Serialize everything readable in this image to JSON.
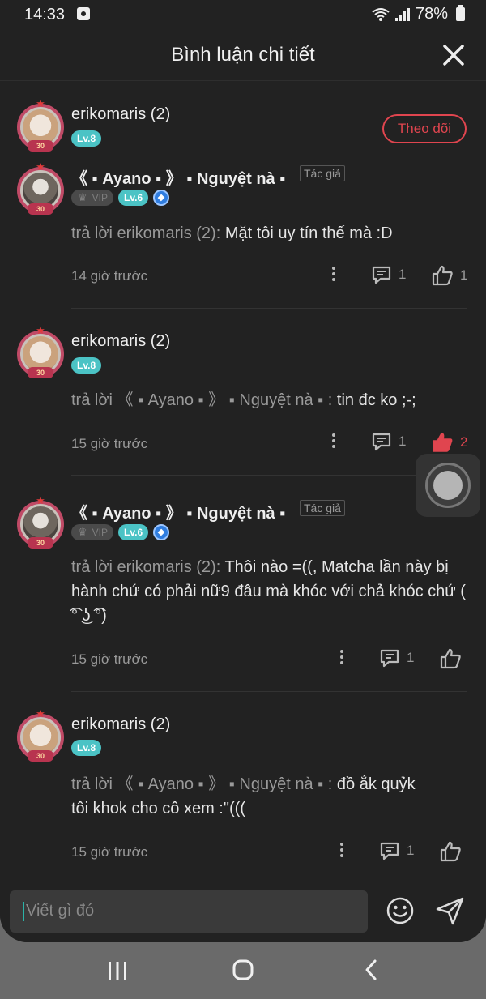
{
  "status_bar": {
    "time": "14:33",
    "battery": "78%"
  },
  "header": {
    "title": "Bình luận chi tiết"
  },
  "follow_label": "Theo dõi",
  "author_tag": "Tác giả",
  "comments": [
    {
      "username": "erikomaris (2)",
      "level": "Lv.8"
    },
    {
      "username": "《 ▪ Ayano ▪ 》 ▪ Nguyệt nà ▪",
      "vip": "VIP",
      "level": "Lv.6",
      "reply_prefix": "trả lời erikomaris (2): ",
      "reply_text": "Mặt tôi uy tín thế mà :D",
      "time": "14 giờ trước",
      "reply_count": "1",
      "like_count": "1"
    },
    {
      "username": "erikomaris (2)",
      "level": "Lv.8",
      "reply_prefix": "trả lời 《 ▪ Ayano ▪ 》 ▪ Nguyệt nà ▪ : ",
      "reply_text": "tin đc ko ;-;",
      "time": "15 giờ trước",
      "reply_count": "1",
      "like_count": "2"
    },
    {
      "username": "《 ▪ Ayano ▪ 》 ▪ Nguyệt nà ▪",
      "vip": "VIP",
      "level": "Lv.6",
      "reply_prefix": "trả lời erikomaris (2): ",
      "reply_text": "Thôi nào =((, Matcha lần này bị hành chứ có phải nữ9 đâu mà khóc với chả khóc chứ ( ͡° ͜ʖ ͡°)",
      "time": "15 giờ trước",
      "reply_count": "1"
    },
    {
      "username": "erikomaris (2)",
      "level": "Lv.8",
      "reply_prefix": "trả lời 《 ▪ Ayano ▪ 》 ▪ Nguyệt nà ▪ : ",
      "reply_text": "đồ ắk quỷk tôi khok cho cô xem :\"(((",
      "time": "15 giờ trước",
      "reply_count": "1"
    }
  ],
  "input": {
    "placeholder": "Viết gì đó"
  },
  "icons": {
    "close": "close-icon",
    "comment": "comment-icon",
    "like": "thumbs-up-icon",
    "emoji": "smiley-icon",
    "send": "send-icon",
    "more": "more-vertical-icon"
  },
  "colors": {
    "accent_red": "#e0454f",
    "level_teal": "#4bc3c5",
    "background": "#222222"
  }
}
